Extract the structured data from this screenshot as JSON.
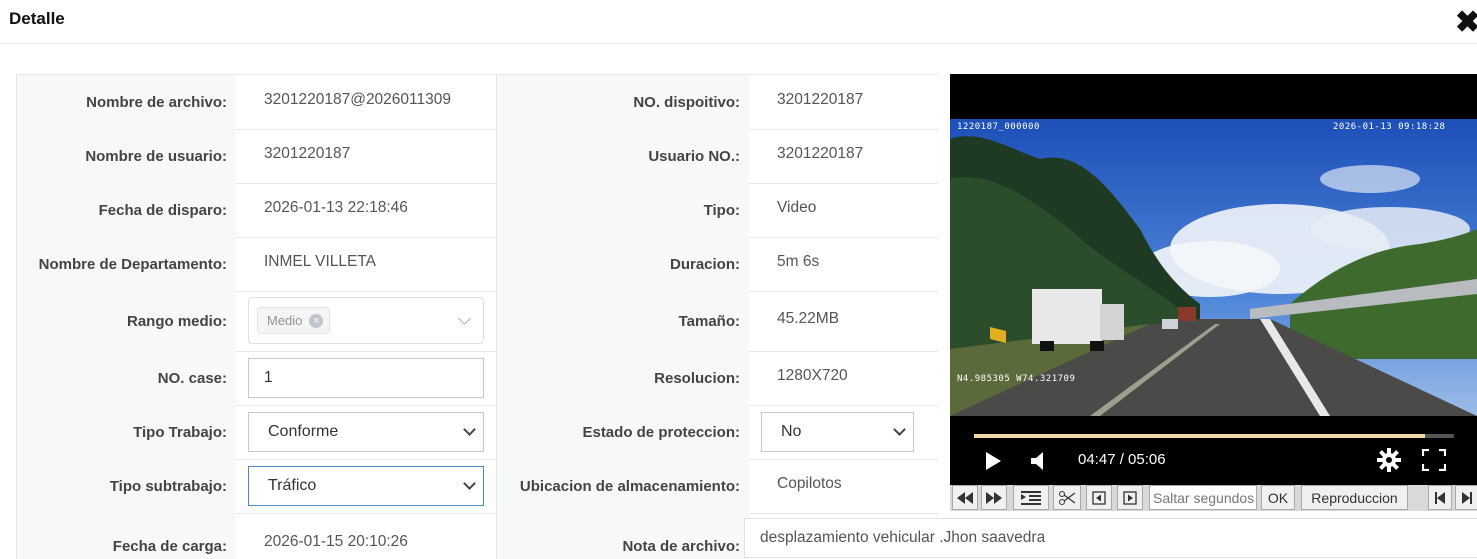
{
  "dialog": {
    "title": "Detalle",
    "close_icon": "close-icon"
  },
  "fields": {
    "nombre_archivo": {
      "label": "Nombre de archivo:",
      "value": "3201220187@2026011309"
    },
    "no_dispositivo": {
      "label": "NO. dispoitivo:",
      "value": "3201220187"
    },
    "nombre_usuario": {
      "label": "Nombre de usuario:",
      "value": "3201220187"
    },
    "usuario_no": {
      "label": "Usuario NO.:",
      "value": "3201220187"
    },
    "fecha_disparo": {
      "label": "Fecha de disparo:",
      "value": "2026-01-13 22:18:46"
    },
    "tipo": {
      "label": "Tipo:",
      "value": "Video"
    },
    "departamento": {
      "label": "Nombre de Departamento:",
      "value": "INMEL VILLETA"
    },
    "duracion": {
      "label": "Duracion:",
      "value": "5m 6s"
    },
    "rango_medio": {
      "label": "Rango medio:",
      "tag": "Medio"
    },
    "tamano": {
      "label": "Tamaño:",
      "value": "45.22MB"
    },
    "no_case": {
      "label": "NO. case:",
      "value": "1"
    },
    "resolucion": {
      "label": "Resolucion:",
      "value": "1280X720"
    },
    "tipo_trabajo": {
      "label": "Tipo Trabajo:",
      "value": "Conforme"
    },
    "estado_proteccion": {
      "label": "Estado de proteccion:",
      "value": "No"
    },
    "tipo_subtrabajo": {
      "label": "Tipo subtrabajo:",
      "value": "Tráfico"
    },
    "ubicacion": {
      "label": "Ubicacion de almacenamiento:",
      "value": "Copilotos"
    },
    "fecha_carga": {
      "label": "Fecha de carga:",
      "value": "2026-01-15 20:10:26"
    },
    "nota": {
      "label": "Nota de archivo:",
      "value": "desplazamiento vehicular .Jhon saavedra"
    }
  },
  "player": {
    "osd_top_left": "1220187_000000",
    "osd_top_right": "2026-01-13 09:18:28",
    "osd_bottom_left": "N4.985305 W74.321709",
    "time": "04:47 / 05:06",
    "progress": 0.94
  },
  "toolbar": {
    "seek_placeholder": "Saltar segundos",
    "ok_label": "OK",
    "playback_label": "Reproduccion"
  },
  "colors": {
    "label_bg": "#f7f8fa",
    "border": "#e6e6e6",
    "progress": "#f0d8a8",
    "focus": "#4a89c8"
  }
}
